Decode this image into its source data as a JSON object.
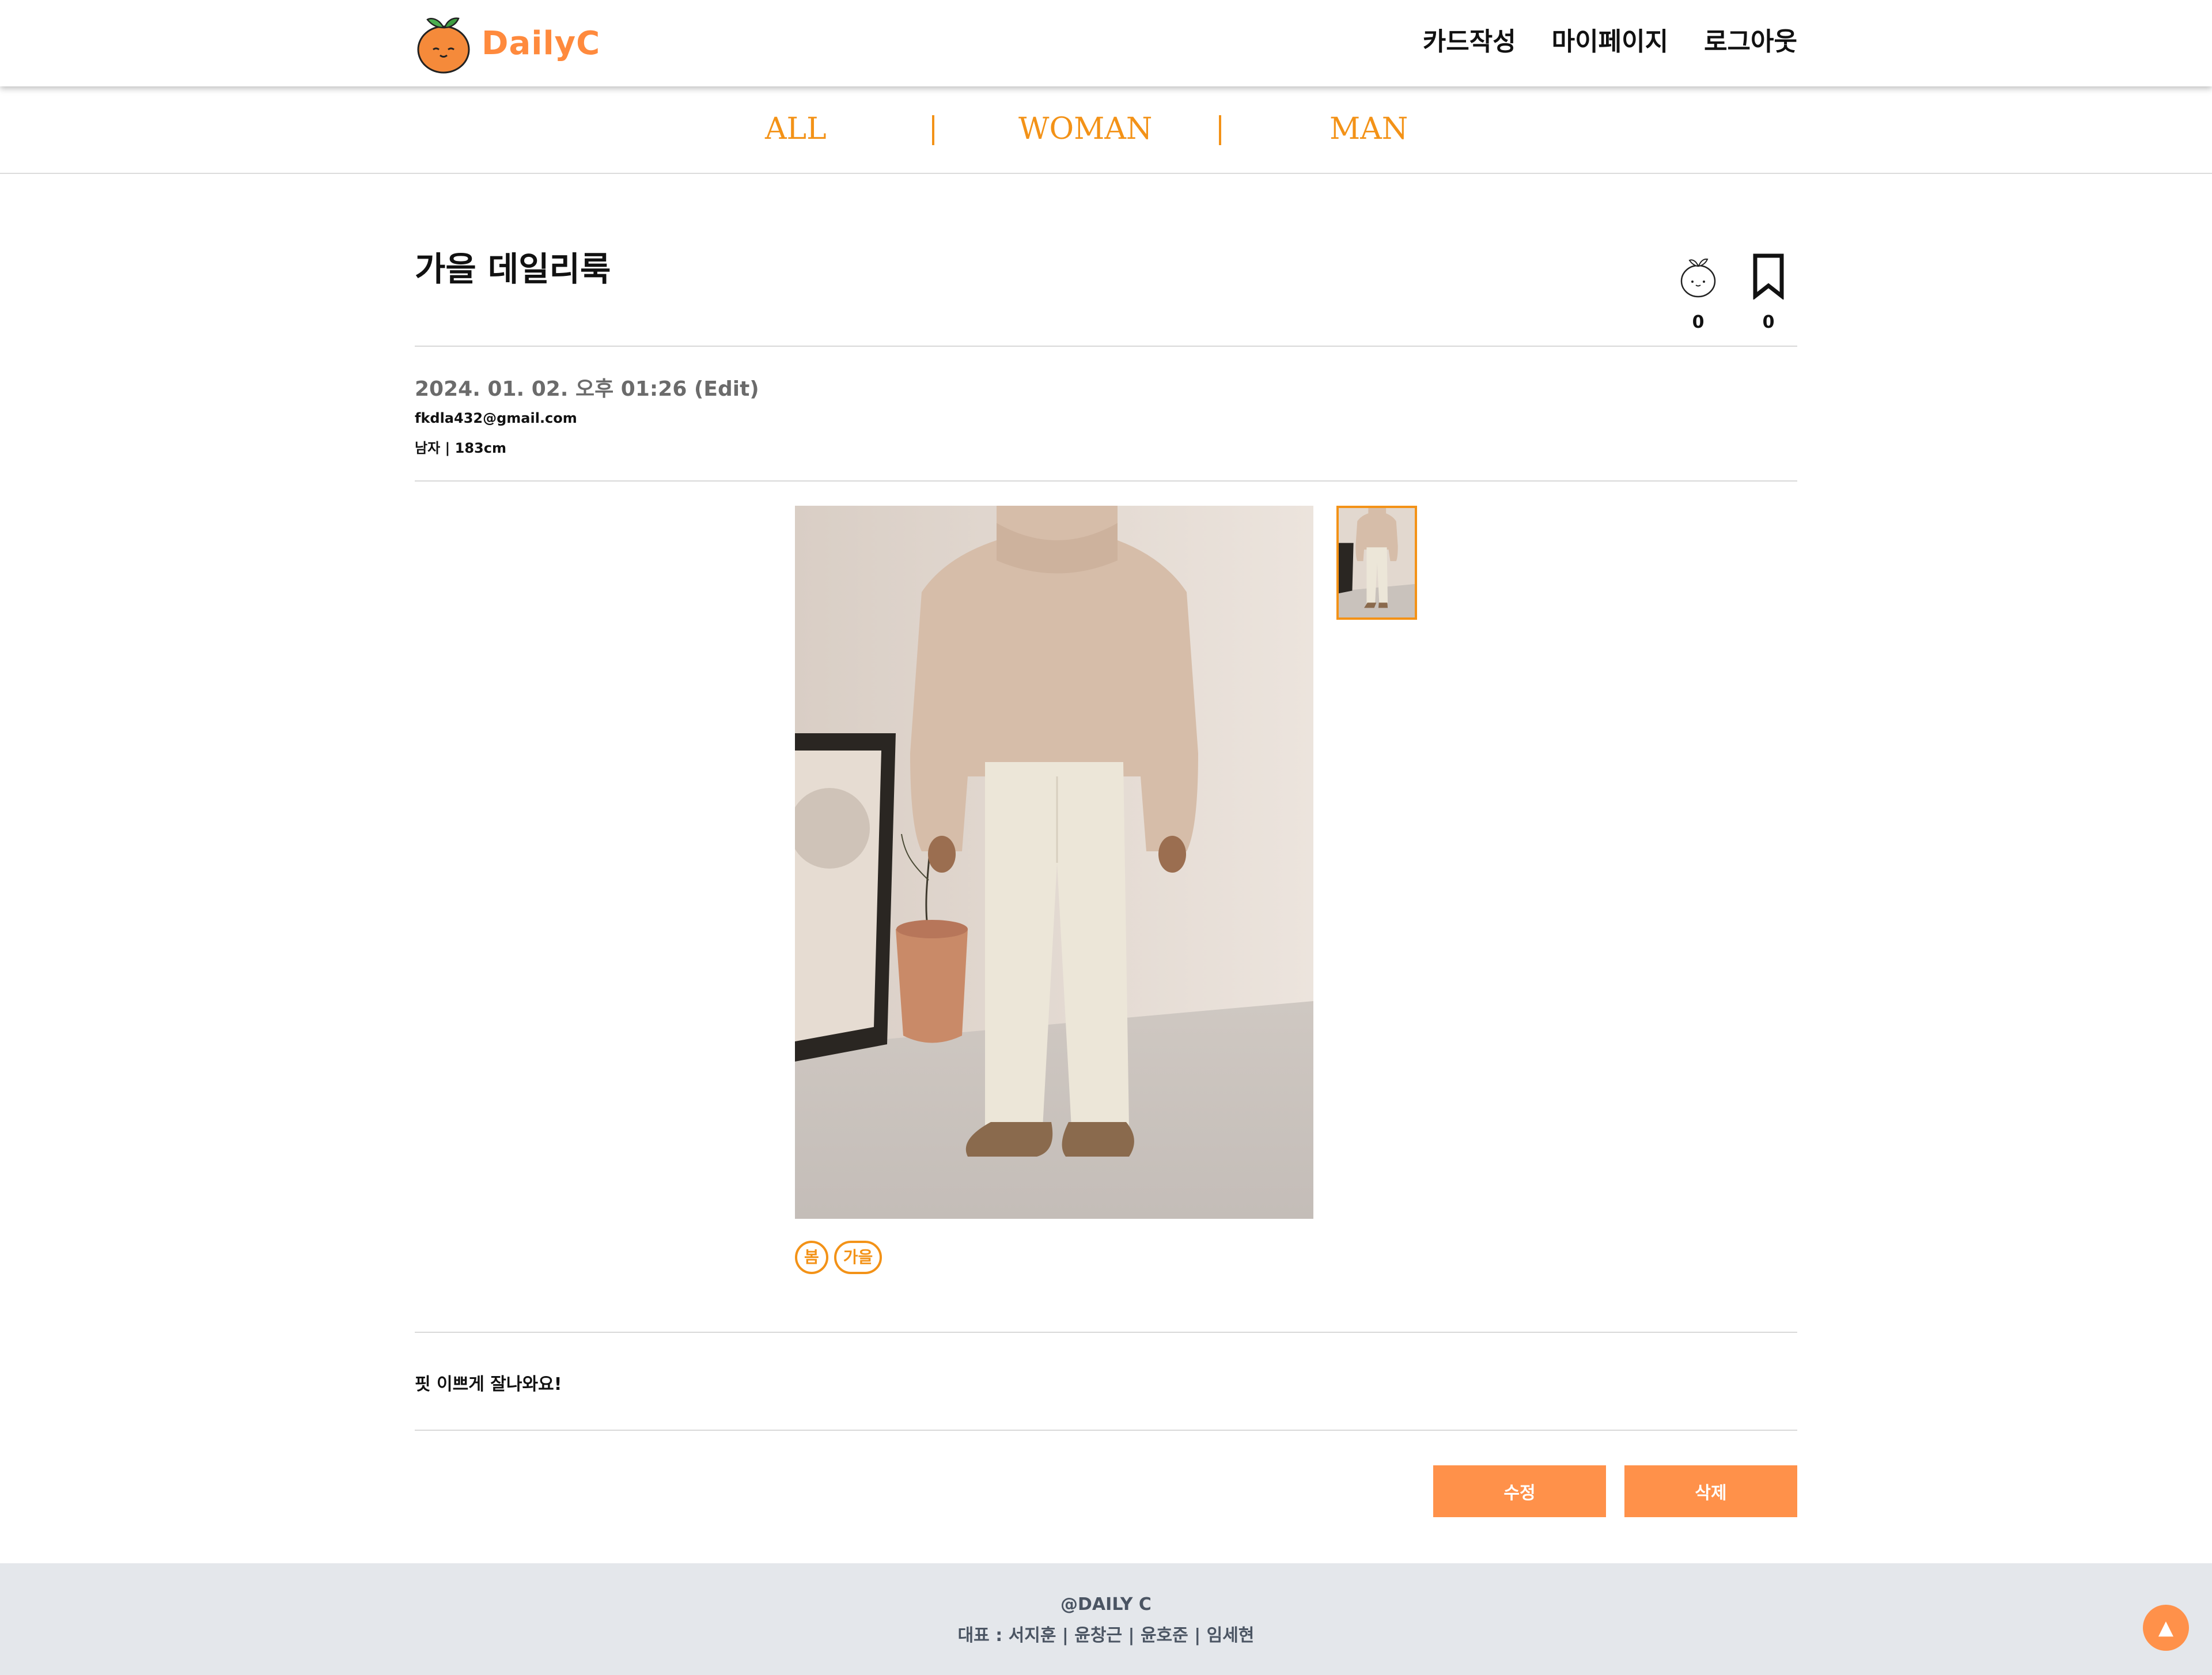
{
  "header": {
    "logo_text": "DailyC",
    "nav": [
      "카드작성",
      "마이페이지",
      "로그아웃"
    ]
  },
  "categories": [
    "ALL",
    "WOMAN",
    "MAN"
  ],
  "post": {
    "title": "가을 데일리룩",
    "like_count": "0",
    "bookmark_count": "0",
    "date": "2024. 01. 02. 오후 01:26 (Edit)",
    "email": "fkdla432@gmail.com",
    "body_info": "남자 | 183cm",
    "tags": [
      "봄",
      "가을"
    ],
    "content": "핏 이쁘게 잘나와요!"
  },
  "actions": {
    "edit_label": "수정",
    "delete_label": "삭제"
  },
  "footer": {
    "brand": "@DAILY C",
    "team": "대표 : 서지훈 | 윤창근 | 윤호준 | 임세현"
  },
  "colors": {
    "accent": "#f39217",
    "button": "#ff914a",
    "footer_bg": "#e4e7eb"
  },
  "icons": {
    "like": "tangerine-icon",
    "bookmark": "bookmark-icon",
    "scroll_top": "arrow-up-icon"
  }
}
